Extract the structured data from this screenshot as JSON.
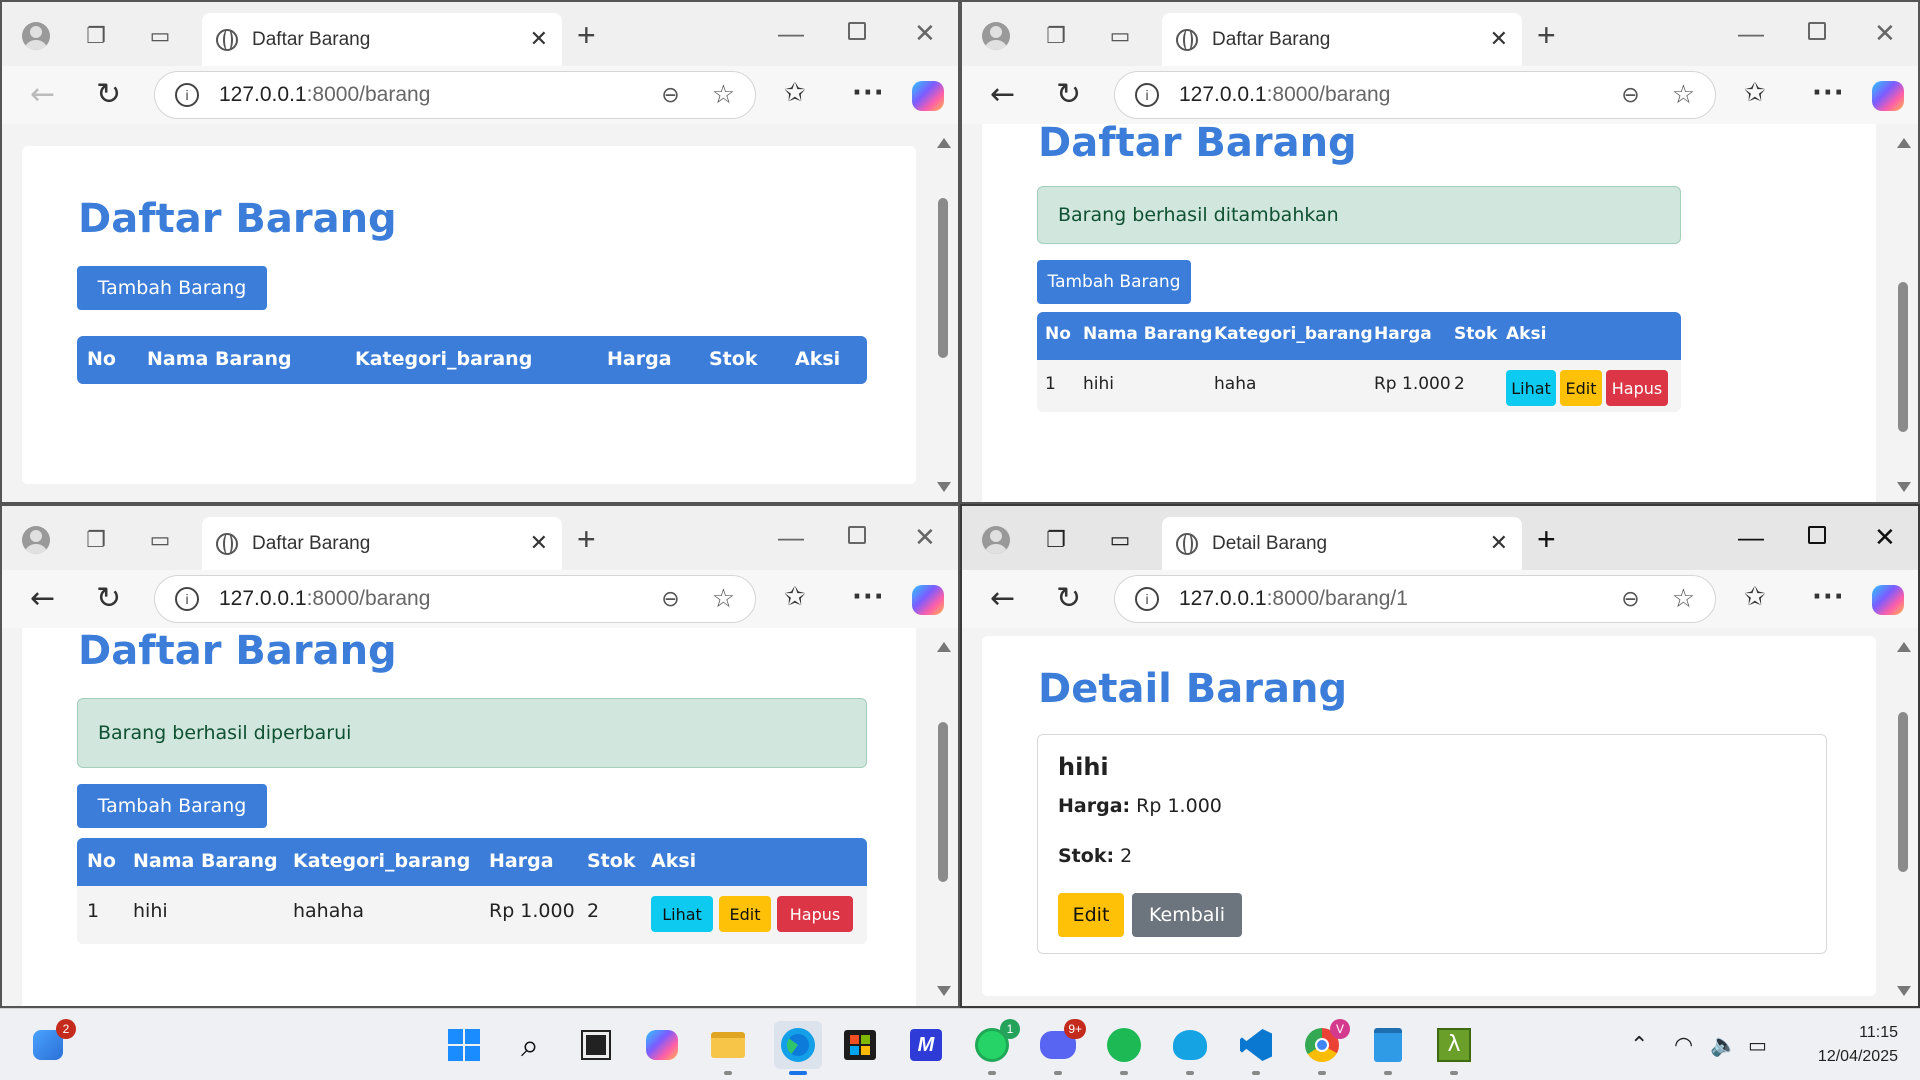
{
  "windows": [
    {
      "tab_title": "Daftar Barang",
      "url_host": "127.0.0.1",
      "url_path": ":8000/barang",
      "heading": "Daftar Barang",
      "add_button": "Tambah Barang",
      "columns": [
        "No",
        "Nama Barang",
        "Kategori_barang",
        "Harga",
        "Stok",
        "Aksi"
      ],
      "scroll_fraction": 0.0
    },
    {
      "tab_title": "Daftar Barang",
      "url_host": "127.0.0.1",
      "url_path": ":8000/barang",
      "heading": "Daftar Barang",
      "alert": "Barang berhasil ditambahkan",
      "add_button": "Tambah Barang",
      "columns": [
        "No",
        "Nama Barang",
        "Kategori_barang",
        "Harga",
        "Stok",
        "Aksi"
      ],
      "row": {
        "no": "1",
        "nama": "hihi",
        "kategori": "haha",
        "harga": "Rp 1.000",
        "stok": "2"
      },
      "actions": [
        "Lihat",
        "Edit",
        "Hapus"
      ]
    },
    {
      "tab_title": "Daftar Barang",
      "url_host": "127.0.0.1",
      "url_path": ":8000/barang",
      "heading": "Daftar Barang",
      "alert": "Barang berhasil diperbarui",
      "add_button": "Tambah Barang",
      "columns": [
        "No",
        "Nama Barang",
        "Kategori_barang",
        "Harga",
        "Stok",
        "Aksi"
      ],
      "row": {
        "no": "1",
        "nama": "hihi",
        "kategori": "hahaha",
        "harga": "Rp 1.000",
        "stok": "2"
      },
      "actions": [
        "Lihat",
        "Edit",
        "Hapus"
      ]
    },
    {
      "tab_title": "Detail Barang",
      "url_host": "127.0.0.1",
      "url_path": ":8000/barang/1",
      "heading": "Detail Barang",
      "item_name": "hihi",
      "harga_label": "Harga:",
      "harga_value": "Rp 1.000",
      "stok_label": "Stok:",
      "stok_value": "2",
      "edit_button": "Edit",
      "back_button": "Kembali"
    }
  ],
  "taskbar": {
    "widgets_badge": "2",
    "whatsapp_badge": "1",
    "discord_badge": "9+",
    "chrome_badge": "V",
    "time": "11:15",
    "date": "12/04/2025"
  },
  "colors": {
    "primary": "#3b7dd8",
    "success_bg": "#d1e7dd",
    "info": "#0dcaf0",
    "warning": "#ffc107",
    "danger": "#dc3545",
    "secondary": "#6c757d"
  }
}
